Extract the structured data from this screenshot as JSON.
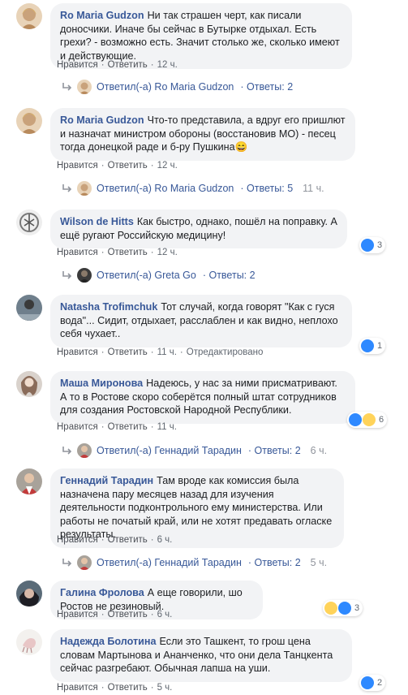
{
  "ui": {
    "like_label": "Нравится",
    "reply_label": "Ответить",
    "replied_prefix": "Ответил(-а)",
    "replies_prefix": "Ответы:",
    "edited_label": "Отредактировано"
  },
  "comments": [
    {
      "author": "Ro Maria Gudzon",
      "text": "Ни так страшен черт, как писали доносчики. Иначе бы сейчас в Бутырке отдыхал. Есть грехи? - возможно есть. Значит столько же, сколько имеют и действующие.",
      "time": "12 ч.",
      "reply": {
        "name": "Ro Maria Gudzon",
        "count": "2",
        "time": ""
      }
    },
    {
      "author": "Ro Maria Gudzon",
      "text": "Что-то представила, а вдруг его пришлют и назначат министром обороны (восстановив МО) - песец тогда донецкой раде и б-ру Пушкина😄",
      "time": "12 ч.",
      "reply": {
        "name": "Ro Maria Gudzon",
        "count": "5",
        "time": "11 ч."
      }
    },
    {
      "author": "Wilson de Hitts",
      "text": "Как быстро, однако, пошёл на поправку. А ещё ругают Российскую медицину!",
      "time": "12 ч.",
      "reactions": {
        "count": "3"
      },
      "reply": {
        "name": "Greta Go",
        "count": "2",
        "time": ""
      }
    },
    {
      "author": "Natasha Trofimchuk",
      "text": "Тот случай, когда говорят \"Как с гуся вода\"... Сидит, отдыхает, расслаблен и как видно, неплохо себя чухает..",
      "time": "11 ч.",
      "reactions": {
        "count": "1"
      }
    },
    {
      "author": "Маша Миронова",
      "text": "Надеюсь, у нас за ними присматривают. А то в Ростове скоро соберётся полный штат сотрудников для создания Ростовской Народной Республики.",
      "time": "11 ч.",
      "reactions": {
        "count": "6"
      },
      "reply": {
        "name": "Геннадий Тарадин",
        "count": "2",
        "time": "6 ч."
      }
    },
    {
      "author": "Геннадий Тарадин",
      "text": "Там вроде как комиссия была назначена пару месяцев назад для изучения деятельности подконтрольного ему министерства. Или работы не початый край, или не хотят предавать огласке результаты.",
      "time": "6 ч.",
      "reply": {
        "name": "Геннадий Тарадин",
        "count": "2",
        "time": "5 ч."
      }
    },
    {
      "author": "Галина Фролова",
      "text": "А еще говорили, шо Ростов не резиновый.",
      "time": "6 ч.",
      "reactions": {
        "count": "3"
      }
    },
    {
      "author": "Надежда Болотина",
      "text": "Если это Ташкент, то грош цена словам Мартынова и Ананченко, что они дела Танцкента сейчас разгребают. Обычная лапша на уши.",
      "time": "5 ч.",
      "reactions": {
        "count": "2"
      }
    }
  ]
}
